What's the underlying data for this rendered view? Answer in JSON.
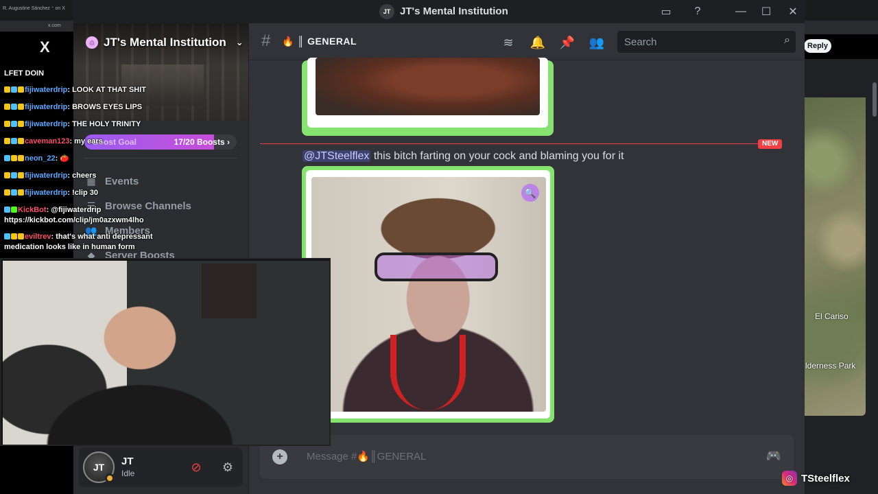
{
  "left_browser": {
    "tab_title": "R. Augustine Sánchez ⁺ on X",
    "url": "x.com",
    "logo_text": "X"
  },
  "right_browser": {
    "reply_label": "Reply",
    "map_labels": [
      "El Cariso",
      "lderness Park"
    ]
  },
  "window": {
    "title": "JT's Mental Institution",
    "server_icon_text": "JT"
  },
  "sidebar": {
    "server_name": "JT's Mental Institution",
    "boost_goal_label": "Boost Goal",
    "boost_count": "17/20 Boosts",
    "boost_progress": 0.85,
    "items": [
      {
        "label": "Events",
        "icon": "calendar-icon"
      },
      {
        "label": "Browse Channels",
        "icon": "browse-icon"
      },
      {
        "label": "Members",
        "icon": "members-icon"
      },
      {
        "label": "Server Boosts",
        "icon": "boost-icon"
      }
    ]
  },
  "user_panel": {
    "avatar_text": "JT",
    "name": "JT",
    "status": "Idle"
  },
  "chat": {
    "channel_name": "GENERAL",
    "channel_emoji": "🔥",
    "search_placeholder": "Search",
    "new_badge": "NEW",
    "mention": "@JTSteelflex",
    "message_text": " this bitch farting on your cock and blaming you for it",
    "composer_placeholder": "Message #🔥║GENERAL"
  },
  "stream_chat": {
    "header": "LFET DOIN",
    "messages": [
      {
        "user": "fijiwaterdrip",
        "user_color": "#5aa9ff",
        "text": ": LOOK AT THAT SHIT"
      },
      {
        "user": "fijiwaterdrip",
        "user_color": "#5aa9ff",
        "text": ": BROWS EYES LIPS"
      },
      {
        "user": "fijiwaterdrip",
        "user_color": "#5aa9ff",
        "text": ": THE HOLY TRINITY"
      },
      {
        "user": "caveman123",
        "user_color": "#ff4d6a",
        "text": ": my ears"
      },
      {
        "user": "neon_22",
        "user_color": "#5aa9ff",
        "text": ": 🍅"
      },
      {
        "user": "fijiwaterdrip",
        "user_color": "#5aa9ff",
        "text": ": cheers"
      },
      {
        "user": "fijiwaterdrip",
        "user_color": "#5aa9ff",
        "text": ": !clip 30"
      },
      {
        "user": "KickBot",
        "user_color": "#ff4d6a",
        "text": ": @fijiwaterdrip https://kickbot.com/clip/jm0azxwm4lho"
      },
      {
        "user": "eviltrev",
        "user_color": "#ff4d6a",
        "text": ": that's what anti depressant medication looks like in human form"
      }
    ]
  },
  "instagram": {
    "handle": "TSteelflex"
  },
  "colors": {
    "discord_bg": "#313338",
    "sidebar_bg": "#2b2d31",
    "image_border": "#86e36f",
    "new_red": "#f23f43",
    "boost_purple": "#9b5cf0"
  }
}
